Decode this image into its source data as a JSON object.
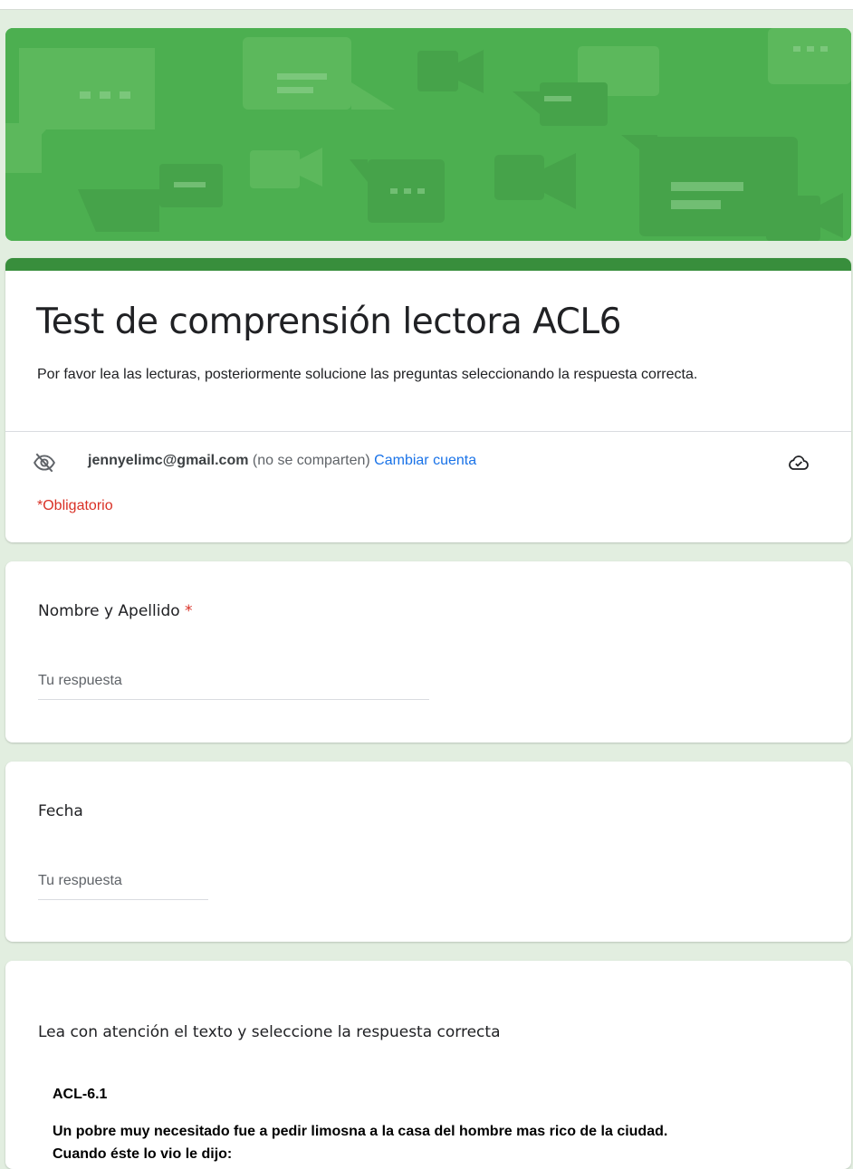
{
  "form": {
    "title": "Test de comprensión lectora ACL6",
    "description": "Por favor lea las lecturas, posteriormente solucione las preguntas seleccionando la respuesta correcta.",
    "account_email": "jennyelimc@gmail.com",
    "account_note": " (no se comparten) ",
    "switch_account": "Cambiar cuenta",
    "required_note": "*Obligatorio",
    "banner_color": "#4caf50",
    "accent_color": "#388e3c"
  },
  "questions": [
    {
      "label": "Nombre y Apellido",
      "required_mark": " *",
      "placeholder": "Tu respuesta"
    },
    {
      "label": "Fecha",
      "placeholder": "Tu respuesta"
    },
    {
      "label": "Lea con atención el texto y seleccione la respuesta correcta",
      "passage_code": "ACL-6.1",
      "passage_line1": "Un pobre muy necesitado fue a pedir limosna a la casa del hombre mas rico de la ciudad.",
      "passage_line2": "Cuando éste lo vio le dijo:"
    }
  ],
  "icons": {
    "privacy": "eye-off-icon",
    "cloud": "cloud-check-icon"
  }
}
